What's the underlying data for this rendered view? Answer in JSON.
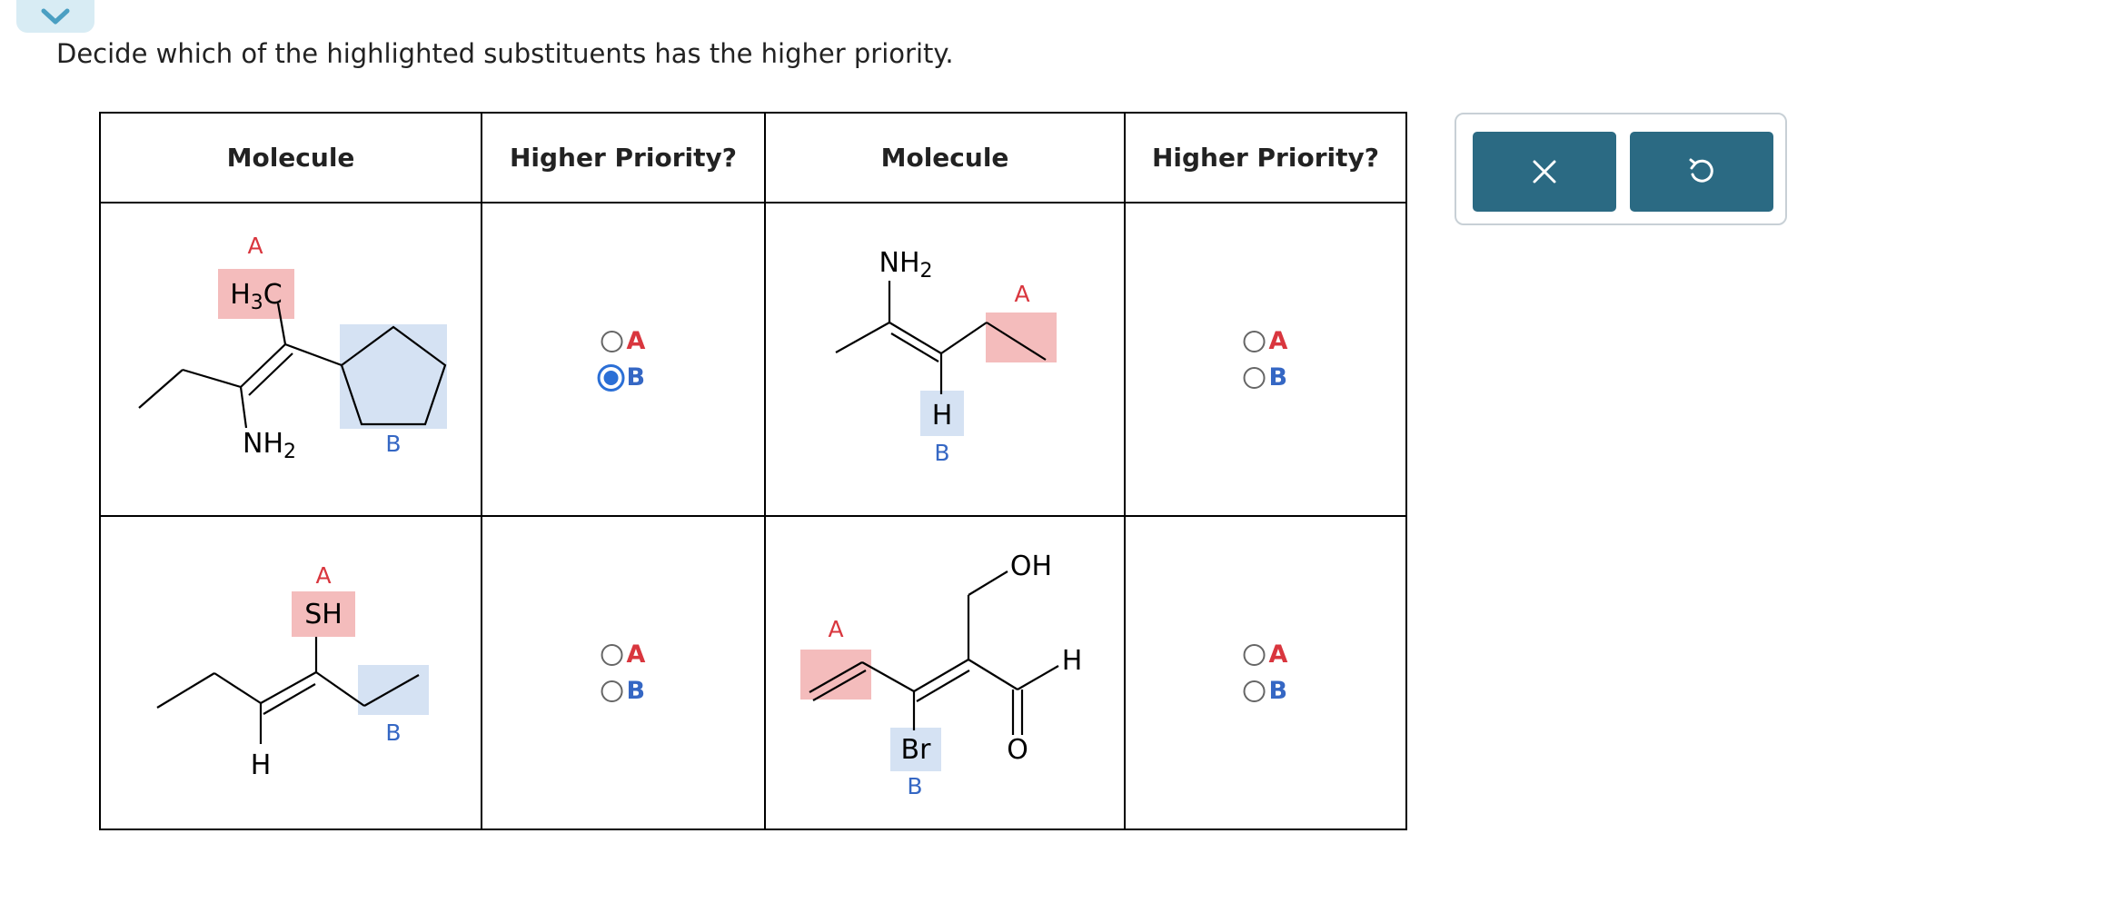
{
  "prompt": "Decide which of the highlighted substituents has the higher priority.",
  "table": {
    "headers": [
      "Molecule",
      "Higher Priority?",
      "Molecule",
      "Higher Priority?"
    ]
  },
  "molecules": {
    "m1": {
      "label_a": "A",
      "label_b": "B",
      "group_a": "H3C",
      "group_b": "cyclopentyl",
      "other": "NH2"
    },
    "m2": {
      "label_a": "A",
      "label_b": "B",
      "group_a": "ethyl",
      "group_b": "H",
      "other": "NH2"
    },
    "m3": {
      "label_a": "A",
      "label_b": "B",
      "group_a": "SH",
      "group_b": "ethyl",
      "other": "H"
    },
    "m4": {
      "label_a": "A",
      "label_b": "B",
      "group_a": "vinyl",
      "group_b": "Br",
      "other_1": "OH",
      "other_2": "H",
      "other_3": "O"
    }
  },
  "answers": [
    {
      "option_a": "A",
      "option_b": "B",
      "selected": "B"
    },
    {
      "option_a": "A",
      "option_b": "B",
      "selected": ""
    },
    {
      "option_a": "A",
      "option_b": "B",
      "selected": ""
    },
    {
      "option_a": "A",
      "option_b": "B",
      "selected": ""
    }
  ],
  "actions": {
    "clear_icon": "x-icon",
    "reset_icon": "undo-icon"
  },
  "colors": {
    "highlight_a": "#f4bcbc",
    "highlight_b": "#d5e2f3",
    "label_a": "#d9363e",
    "label_b": "#3567c4",
    "selected_radio": "#2b6fd6",
    "action_button": "#2b6a83",
    "tab_bg": "#d8ecf4"
  }
}
